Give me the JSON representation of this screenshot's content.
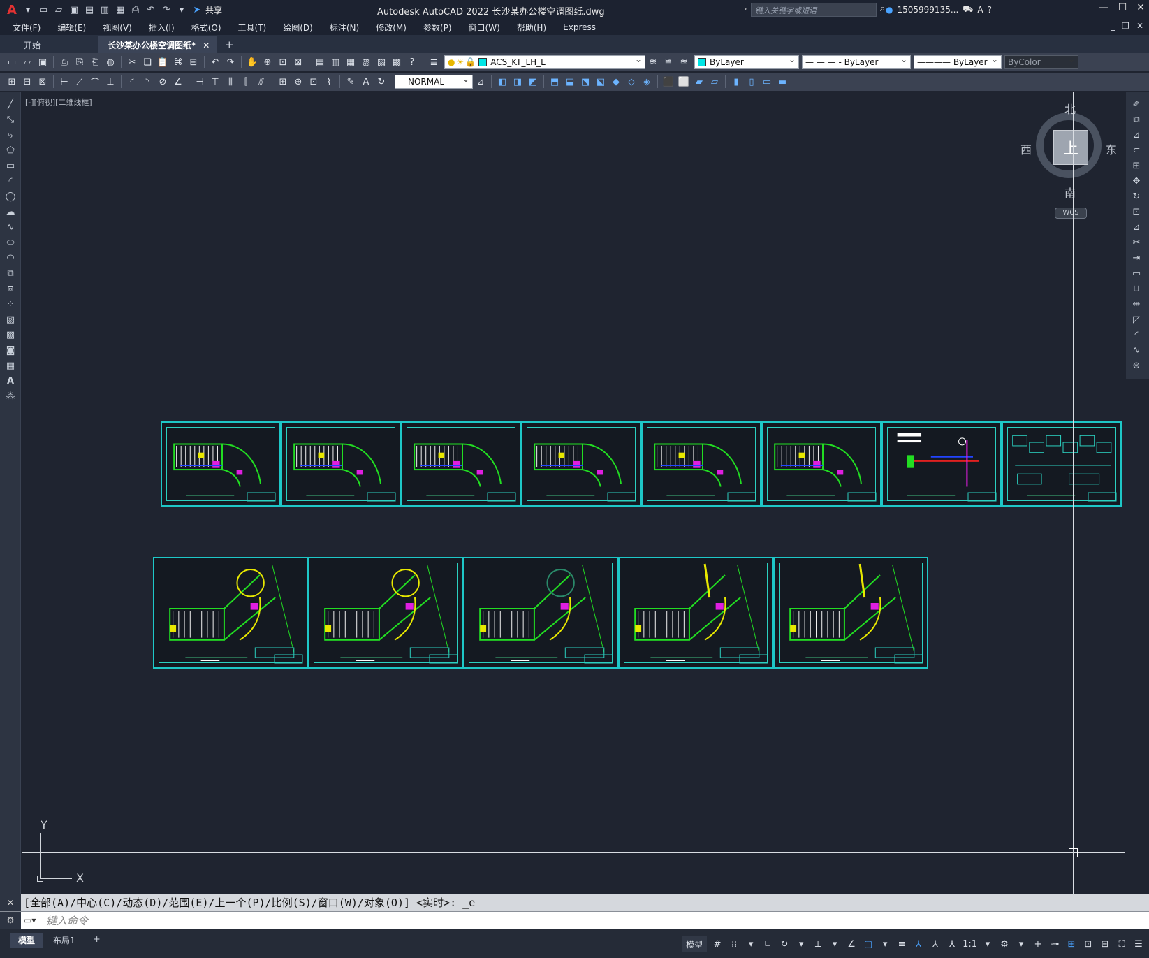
{
  "titlebar": {
    "logo": "A",
    "share_label": "共享",
    "title": "Autodesk AutoCAD 2022    长沙某办公楼空调图纸.dwg",
    "search_placeholder": "键入关键字或短语",
    "user": "1505999135...",
    "help": "?"
  },
  "menus": [
    "文件(F)",
    "编辑(E)",
    "视图(V)",
    "插入(I)",
    "格式(O)",
    "工具(T)",
    "绘图(D)",
    "标注(N)",
    "修改(M)",
    "参数(P)",
    "窗口(W)",
    "帮助(H)",
    "Express"
  ],
  "tabs": {
    "start": "开始",
    "drawing": "长沙某办公楼空调图纸*",
    "close": "✕",
    "add": "+"
  },
  "toolbar1": {
    "layer": "ACS_KT_LH_L",
    "color": "ByLayer",
    "color_swatch": "#00e5e5",
    "linetype": "— — — - ByLayer",
    "lineweight": "———— ByLayer",
    "plotstyle": "ByColor"
  },
  "toolbar2": {
    "dimstyle": "NORMAL"
  },
  "canvas": {
    "view_label": "[-][俯视][二维线框]",
    "viewcube": {
      "top": "上",
      "north": "北",
      "south": "南",
      "east": "东",
      "west": "西",
      "wcs": "WCS"
    },
    "ucs": {
      "x": "X",
      "y": "Y"
    },
    "sheet_row1_count": 8,
    "sheet_row2_count": 5
  },
  "command": {
    "history": "[全部(A)/中心(C)/动态(D)/范围(E)/上一个(P)/比例(S)/窗口(W)/对象(O)] <实时>: _e",
    "placeholder": "键入命令",
    "close": "✕",
    "wrench": "🔧"
  },
  "status": {
    "layout_tabs": [
      "模型",
      "布局1"
    ],
    "add": "+",
    "model": "模型",
    "scale": "1:1"
  }
}
